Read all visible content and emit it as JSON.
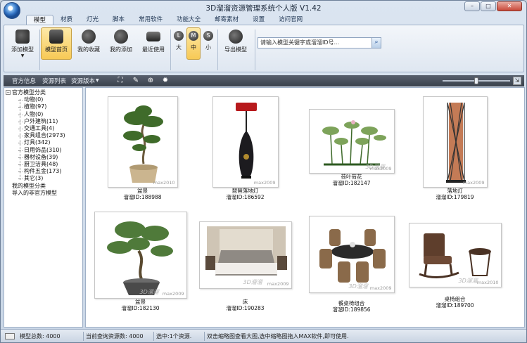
{
  "window": {
    "title": "3D溜溜资源管理系统个人版 V1.42",
    "controls": {
      "minimize": "–",
      "maximize": "□",
      "close": "✕"
    }
  },
  "menu": {
    "tabs": [
      "模型",
      "材质",
      "灯光",
      "脚本",
      "常用软件",
      "功能大全",
      "邮寄素材",
      "设置",
      "访问官网"
    ],
    "active": "模型"
  },
  "ribbon": {
    "add_model": "添加模型",
    "model_home": "模型首页",
    "my_favorites": "我的收藏",
    "my_added": "我的添加",
    "recent": "最近使用",
    "size_large_glyph": "L",
    "size_large": "大",
    "size_medium_glyph": "M",
    "size_medium": "中",
    "size_small_glyph": "S",
    "size_small": "小",
    "export_model": "导出模型",
    "search_placeholder": "请输入模型关键字或溜溜ID号..."
  },
  "toolbar": {
    "official_info": "官方信息",
    "resource_list": "资源列表",
    "resource_version": "资源版本",
    "slider_position": 0.5
  },
  "tree": {
    "root": "官方模型分类",
    "children": [
      "动物(0)",
      "植物(97)",
      "人物(0)",
      "户外建筑(11)",
      "交通工具(4)",
      "家具组合(2973)",
      "灯具(342)",
      "日用饰品(310)",
      "器材设备(39)",
      "厨卫洁具(48)",
      "构件五金(173)",
      "其它(3)"
    ],
    "my_category": "我的模型分类",
    "imported": "导入的非官方模型"
  },
  "models": [
    {
      "name": "盆景",
      "id": "溜溜ID:188988",
      "wm": "max2010",
      "icon": "bonsai-thumbnail"
    },
    {
      "name": "琵琶落地灯",
      "id": "溜溜ID:186592",
      "wm": "max2009",
      "icon": "pipa-floor-lamp-thumbnail"
    },
    {
      "name": "荷叶荷花",
      "id": "溜溜ID:182147",
      "wm": "max2009",
      "icon": "lotus-thumbnail"
    },
    {
      "name": "落地灯",
      "id": "溜溜ID:179819",
      "wm": "max2009",
      "icon": "floor-lamp-thumbnail"
    },
    {
      "name": "盆景",
      "id": "溜溜ID:182130",
      "wm": "max2009",
      "icon": "bonsai-thumbnail"
    },
    {
      "name": "床",
      "id": "溜溜ID:190283",
      "wm": "max2009",
      "icon": "bed-thumbnail"
    },
    {
      "name": "餐桌椅组合",
      "id": "溜溜ID:189856",
      "wm": "max2009",
      "icon": "dining-set-thumbnail"
    },
    {
      "name": "桌椅组合",
      "id": "溜溜ID:189700",
      "wm": "max2010",
      "icon": "rocking-chair-set-thumbnail"
    }
  ],
  "watermark_logo": "3D溜溜",
  "status": {
    "total": "模型总数: 4000",
    "query": "当前查询资源数: 4000",
    "selected": "选中:1个资源.",
    "hint": "双击缩略图查看大图,选中缩略图拖入MAX软件,即可使用."
  }
}
